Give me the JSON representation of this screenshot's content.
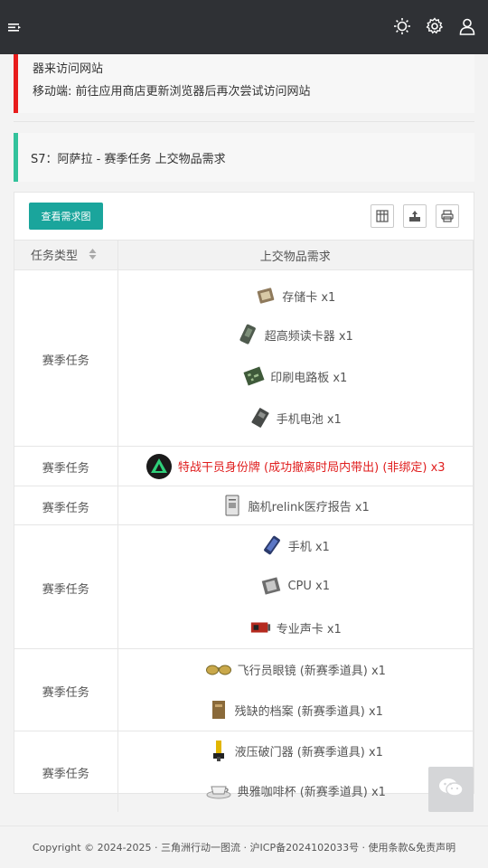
{
  "header": {
    "menu_icon": "menu-fold-icon",
    "icons": [
      "sun-icon",
      "settings-icon",
      "user-icon"
    ]
  },
  "alert": {
    "line1": "器来访问网站",
    "line2": "移动端: 前往应用商店更新浏览器后再次尝试访问网站"
  },
  "section": {
    "title": "S7：阿萨拉 - 赛季任务 上交物品需求"
  },
  "toolbar": {
    "view_chart": "查看需求图",
    "icons": [
      "columns-icon",
      "export-icon",
      "print-icon"
    ]
  },
  "table": {
    "headers": [
      "任务类型",
      "上交物品需求"
    ],
    "rows": [
      {
        "type": "赛季任务",
        "items": [
          "存储卡 x1",
          "超高频读卡器 x1",
          "印刷电路板 x1",
          "手机电池 x1"
        ]
      },
      {
        "type": "赛季任务",
        "items": [
          "特战干员身份牌 (成功撤离时局内带出) (非绑定)  x3"
        ]
      },
      {
        "type": "赛季任务",
        "items": [
          "脑机relink医疗报告 x1"
        ]
      },
      {
        "type": "赛季任务",
        "items": [
          "手机 x1",
          "CPU x1",
          "专业声卡 x1"
        ]
      },
      {
        "type": "赛季任务",
        "items": [
          "飞行员眼镜 (新赛季道具) x1",
          "残缺的档案 (新赛季道具) x1"
        ]
      },
      {
        "type": "赛季任务",
        "items": [
          "液压破门器 (新赛季道具) x1",
          "典雅咖啡杯 (新赛季道具) x1"
        ]
      }
    ]
  },
  "footer": {
    "text": "Copyright © 2024-2025 · 三角洲行动一图流 · 沪ICP备2024102033号 · 使用条款&免责声明"
  },
  "colors": {
    "header_bg": "#2f3135",
    "alert_red": "#e81c1c",
    "accent_green": "#33c29c",
    "button_teal": "#1aa59c"
  }
}
